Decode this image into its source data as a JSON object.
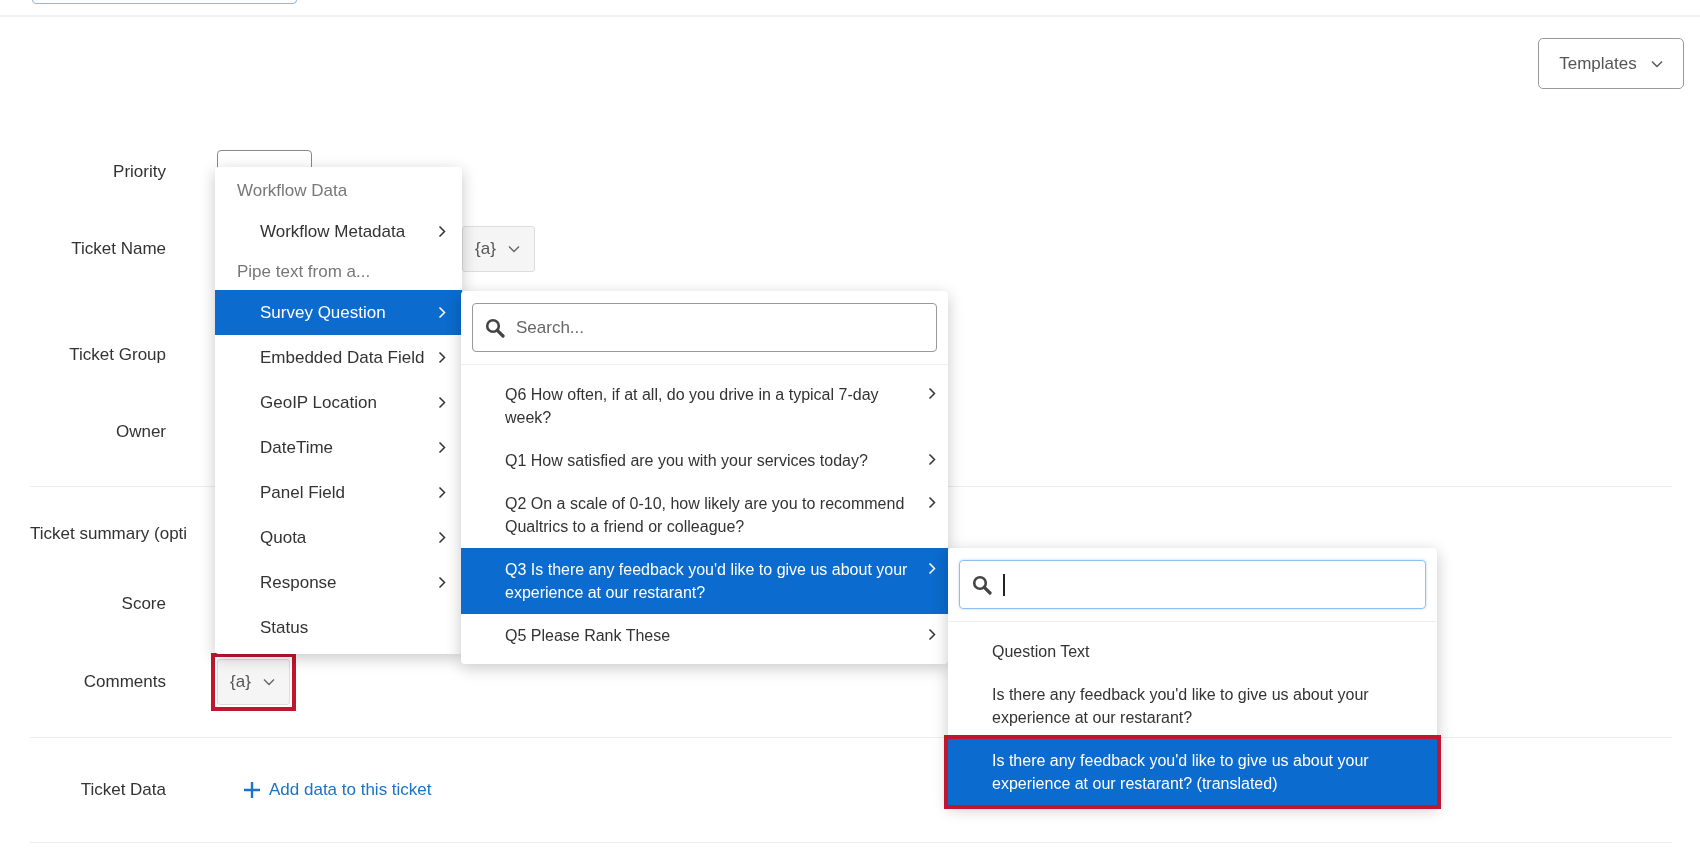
{
  "header": {
    "templates_button": {
      "label": "Templates"
    }
  },
  "sections": [
    {
      "rows": [
        {
          "label": "Priority",
          "control": {
            "kind": "select"
          }
        },
        {
          "label": "Ticket Name",
          "control": {
            "kind": "pipe",
            "label": "{a}",
            "highlighted": false
          }
        },
        {
          "label": "Ticket Group"
        },
        {
          "label": "Owner"
        }
      ]
    },
    {
      "rows": [
        {
          "label": "Ticket summary (opti"
        },
        {
          "label": "Score"
        },
        {
          "label": "Comments",
          "control": {
            "kind": "pipe",
            "label": "{a}",
            "highlighted": true
          }
        }
      ]
    },
    {
      "rows": [
        {
          "label": "Ticket Data",
          "control": {
            "kind": "link",
            "label": "Add data to this ticket"
          }
        }
      ]
    }
  ],
  "pipe_menu": {
    "items": [
      {
        "kind": "header",
        "label": "Workflow Data"
      },
      {
        "kind": "item",
        "label": "Workflow Metadata",
        "submenu": true,
        "selected": false
      },
      {
        "kind": "header",
        "label": "Pipe text from a..."
      },
      {
        "kind": "item",
        "label": "Survey Question",
        "submenu": true,
        "selected": true
      },
      {
        "kind": "item",
        "label": "Embedded Data Field",
        "submenu": true,
        "selected": false
      },
      {
        "kind": "item",
        "label": "GeoIP Location",
        "submenu": true,
        "selected": false
      },
      {
        "kind": "item",
        "label": "DateTime",
        "submenu": true,
        "selected": false
      },
      {
        "kind": "item",
        "label": "Panel Field",
        "submenu": true,
        "selected": false
      },
      {
        "kind": "item",
        "label": "Quota",
        "submenu": true,
        "selected": false
      },
      {
        "kind": "item",
        "label": "Response",
        "submenu": true,
        "selected": false
      },
      {
        "kind": "item",
        "label": "Status",
        "submenu": false,
        "selected": false
      }
    ]
  },
  "question_menu": {
    "search": {
      "placeholder": "Search...",
      "focused": false
    },
    "items": [
      {
        "label": "Q6 How often, if at all, do you drive in a typical 7-day week?",
        "submenu": true,
        "selected": false,
        "highlighted": false
      },
      {
        "label": "Q1 How satisfied are you with your services today?",
        "submenu": true,
        "selected": false,
        "highlighted": false
      },
      {
        "label": "Q2 On a scale of 0-10, how likely are you to recommend Qualtrics to a friend or colleague?",
        "submenu": true,
        "selected": false,
        "highlighted": false
      },
      {
        "label": "Q3 Is there any feedback you'd like to give us about your experience at our restarant?",
        "submenu": true,
        "selected": true,
        "highlighted": false
      },
      {
        "label": "Q5 Please Rank These",
        "submenu": true,
        "selected": false,
        "highlighted": false
      }
    ]
  },
  "field_menu": {
    "search": {
      "focused": true
    },
    "items": [
      {
        "label": "Question Text",
        "submenu": false,
        "selected": false,
        "highlighted": false
      },
      {
        "label": "Is there any feedback you'd like to give us about your experience at our restarant?",
        "submenu": false,
        "selected": false,
        "highlighted": false
      },
      {
        "label": "Is there any feedback you'd like to give us about your experience at our restarant? (translated)",
        "submenu": false,
        "selected": true,
        "highlighted": true
      }
    ]
  }
}
